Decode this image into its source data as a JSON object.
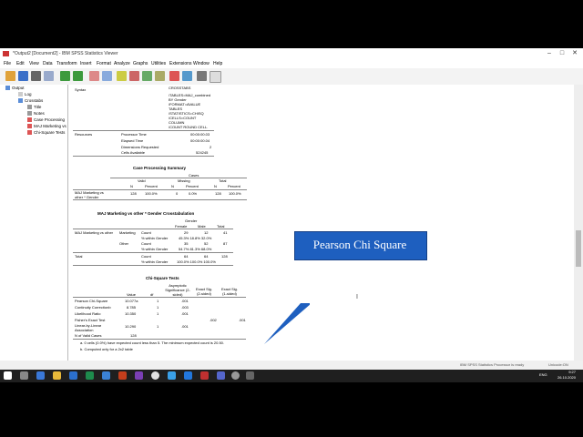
{
  "window": {
    "title": "*Output2 [Document2] - IBM SPSS Statistics Viewer",
    "controls": [
      "–",
      "□",
      "✕"
    ]
  },
  "menu": [
    "File",
    "Edit",
    "View",
    "Data",
    "Transform",
    "Insert",
    "Format",
    "Analyze",
    "Graphs",
    "Utilities",
    "Extensions",
    "Window",
    "Help"
  ],
  "tree": {
    "items": [
      "Output",
      "Log",
      "Crosstabs",
      "Title",
      "Notes",
      "Case Processing",
      "MAJ Marketing vs",
      "Chi-Square Tests"
    ]
  },
  "syntax": {
    "label": "Syntax",
    "lines": [
      "CROSSTABS",
      "/TABLES=MAJ_combined",
      "BY Gender",
      "/FORMAT=AVALUE",
      "TABLES",
      "/STATISTICS=CHISQ",
      "/CELLS=COUNT",
      "COLUMN",
      "/COUNT ROUND CELL."
    ]
  },
  "resources": {
    "label": "Resources",
    "rows": [
      {
        "k": "Processor Time",
        "v": "00:00:00.03"
      },
      {
        "k": "Elapsed Time",
        "v": "00:00:00.04"
      },
      {
        "k": "Dimensions Requested",
        "v": "2"
      },
      {
        "k": "Cells Available",
        "v": "524245"
      }
    ]
  },
  "case_processing": {
    "title": "Case Processing Summary",
    "group": "Cases",
    "subgroups": [
      "Valid",
      "Missing",
      "Total"
    ],
    "headers": [
      "N",
      "Percent",
      "N",
      "Percent",
      "N",
      "Percent"
    ],
    "row_label": "MAJ Marketing vs other * Gender",
    "values": [
      "128",
      "100.0%",
      "0",
      "0.0%",
      "128",
      "100.0%"
    ]
  },
  "crosstab": {
    "title": "MAJ Marketing vs other * Gender Crosstabulation",
    "group": "Gender",
    "columns": [
      "Female",
      "Male",
      "Total"
    ],
    "row_header": "MAJ Marketing vs other",
    "rows": [
      {
        "cat": "Marketing",
        "stat": "Count",
        "v": [
          "29",
          "12",
          "41"
        ]
      },
      {
        "cat": "",
        "stat": "% within Gender",
        "v": "45.3%|18.8%|32.0%"
      },
      {
        "cat": "Other",
        "stat": "Count",
        "v": [
          "35",
          "52",
          "87"
        ]
      },
      {
        "cat": "",
        "stat": "% within Gender",
        "v": "54.7%|81.3%|68.0%"
      },
      {
        "cat": "Total",
        "stat": "Count",
        "v": [
          "64",
          "64",
          "128"
        ]
      },
      {
        "cat": "",
        "stat": "% within Gender",
        "v": "100.0%|100.0%|100.0%"
      }
    ]
  },
  "chi_square": {
    "title": "Chi-Square Tests",
    "headers": [
      "Value",
      "df",
      "Asymptotic Significance (2-sided)",
      "Exact Sig. (2-sided)",
      "Exact Sig. (1-sided)"
    ],
    "rows": [
      {
        "label": "Pearson Chi-Square",
        "value": "10.077a",
        "df": "1",
        "asym": ".001",
        "exact2": "",
        "exact1": ""
      },
      {
        "label": "Continuity Correctionb",
        "value": "8.785",
        "df": "1",
        "asym": ".003",
        "exact2": "",
        "exact1": ""
      },
      {
        "label": "Likelihood Ratio",
        "value": "10.350",
        "df": "1",
        "asym": ".001",
        "exact2": "",
        "exact1": ""
      },
      {
        "label": "Fisher's Exact Test",
        "value": "",
        "df": "",
        "asym": "",
        "exact2": ".002",
        "exact1": ".001"
      },
      {
        "label": "Linear-by-Linear Association",
        "value": "10.290",
        "df": "1",
        "asym": ".001",
        "exact2": "",
        "exact1": ""
      },
      {
        "label": "N of Valid Cases",
        "value": "128",
        "df": "",
        "asym": "",
        "exact2": "",
        "exact1": ""
      }
    ],
    "footnotes": [
      "a. 0 cells (0.0%) have expected count less than 5. The minimum expected count is 20.50.",
      "b. Computed only for a 2x2 table"
    ]
  },
  "callout": {
    "text": "Pearson Chi Square",
    "color": "#1e5fbf"
  },
  "statusbar": {
    "left": "IBM SPSS Statistics Processor is ready",
    "right": "Unicode:ON"
  },
  "clock": {
    "time": "9:27",
    "date": "26.10.2020",
    "lang": "ENG"
  }
}
